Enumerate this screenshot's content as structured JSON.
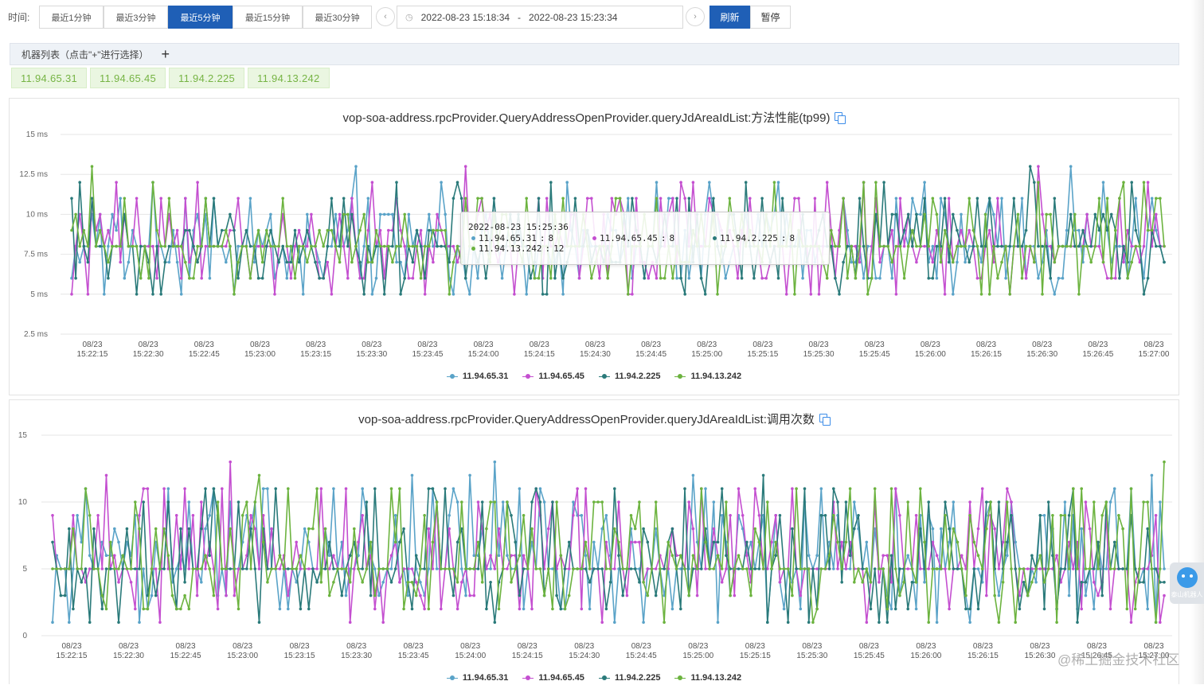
{
  "toolbar": {
    "time_label": "时间:",
    "quick_ranges": [
      "最近1分钟",
      "最近3分钟",
      "最近5分钟",
      "最近15分钟",
      "最近30分钟"
    ],
    "active_range_index": 2,
    "range_start": "2022-08-23 15:18:34",
    "range_separator": "-",
    "range_end": "2022-08-23 15:23:34",
    "prev_icon": "chevron-left-icon",
    "next_icon": "chevron-right-icon",
    "clock_icon": "clock-icon",
    "refresh_label": "刷新",
    "pause_label": "暂停",
    "accent_color": "#1f5fb6"
  },
  "machines": {
    "title": "机器列表（点击\"+\"进行选择）",
    "add_icon": "plus-icon",
    "items": [
      "11.94.65.31",
      "11.94.65.45",
      "11.94.2.225",
      "11.94.13.242"
    ]
  },
  "series_colors": [
    "#5aa3c8",
    "#c44fd0",
    "#2a7a7a",
    "#6cb33f"
  ],
  "chart_data": [
    {
      "type": "line",
      "title": "vop-soa-address.rpcProvider.QueryAddressOpenProvider.queryJdAreaIdList:方法性能(tp99)",
      "ylabel": "",
      "y_ticks": [
        "2.5 ms",
        "5 ms",
        "7.5 ms",
        "10 ms",
        "12.5 ms",
        "15 ms"
      ],
      "ylim": [
        2.5,
        15
      ],
      "x_ticks": [
        "15:22:15",
        "15:22:30",
        "15:22:45",
        "15:23:00",
        "15:23:15",
        "15:23:30",
        "15:23:45",
        "15:24:00",
        "15:24:15",
        "15:24:30",
        "15:24:45",
        "15:25:00",
        "15:25:15",
        "15:25:30",
        "15:25:45",
        "15:26:00",
        "15:26:15",
        "15:26:30",
        "15:26:45",
        "15:27:00"
      ],
      "x_date": "08/23",
      "grid": true,
      "legend_placement": "bottom",
      "series_names": [
        "11.94.65.31",
        "11.94.65.45",
        "11.94.2.225",
        "11.94.13.242"
      ],
      "points_per_series": 270,
      "value_range": [
        5,
        13
      ],
      "base_value": 8,
      "tooltip": {
        "time": "2022-08-23 15:25:36",
        "entries": [
          {
            "name": "11.94.65.31",
            "value": "8"
          },
          {
            "name": "11.94.65.45",
            "value": "8"
          },
          {
            "name": "11.94.2.225",
            "value": "8"
          },
          {
            "name": "11.94.13.242",
            "value": "12"
          }
        ]
      }
    },
    {
      "type": "line",
      "title": "vop-soa-address.rpcProvider.QueryAddressOpenProvider.queryJdAreaIdList:调用次数",
      "ylabel": "",
      "y_ticks": [
        "0",
        "5",
        "10",
        "15"
      ],
      "ylim": [
        0,
        15
      ],
      "x_ticks": [
        "15:22:15",
        "15:22:30",
        "15:22:45",
        "15:23:00",
        "15:23:15",
        "15:23:30",
        "15:23:45",
        "15:24:00",
        "15:24:15",
        "15:24:30",
        "15:24:45",
        "15:25:00",
        "15:25:15",
        "15:25:30",
        "15:25:45",
        "15:26:00",
        "15:26:15",
        "15:26:30",
        "15:26:45",
        "15:27:00"
      ],
      "x_date": "08/23",
      "grid": true,
      "legend_placement": "bottom",
      "series_names": [
        "11.94.65.31",
        "11.94.65.45",
        "11.94.2.225",
        "11.94.13.242"
      ],
      "points_per_series": 270,
      "value_range": [
        1,
        13
      ],
      "base_value": 5
    }
  ],
  "copy_icon": "copy-icon",
  "robot": {
    "icon": "robot-icon",
    "label": "泰山机器人"
  },
  "watermark": "@稀土掘金技术社区"
}
